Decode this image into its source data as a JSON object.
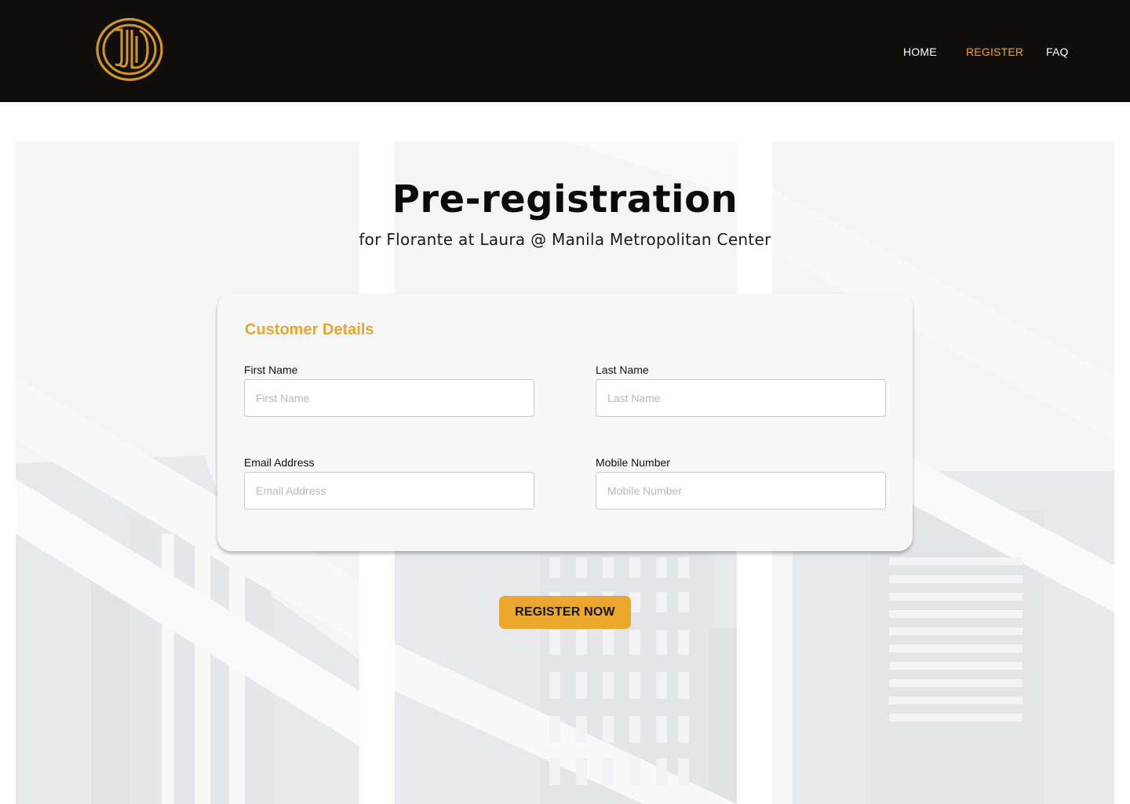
{
  "nav": {
    "home_label": "HOME",
    "register_label": "REGISTER",
    "faq_label": "FAQ"
  },
  "hero": {
    "title": "Pre-registration",
    "subtitle": "for Florante at Laura @ Manila Metropolitan Center"
  },
  "form": {
    "section_title": "Customer Details",
    "first_name": {
      "label": "First Name",
      "placeholder": "First Name",
      "value": ""
    },
    "last_name": {
      "label": "Last Name",
      "placeholder": "Last Name",
      "value": ""
    },
    "email": {
      "label": "Email Address",
      "placeholder": "Email Address",
      "value": ""
    },
    "mobile": {
      "label": "Mobile Number",
      "placeholder": "Mobile Number",
      "value": ""
    },
    "submit_label": "REGISTER NOW"
  },
  "colors": {
    "header_bg": "#110f0d",
    "accent": "#eaa72b",
    "card_bg": "#f7f7f7",
    "building_grey": "#e6e7ea"
  }
}
